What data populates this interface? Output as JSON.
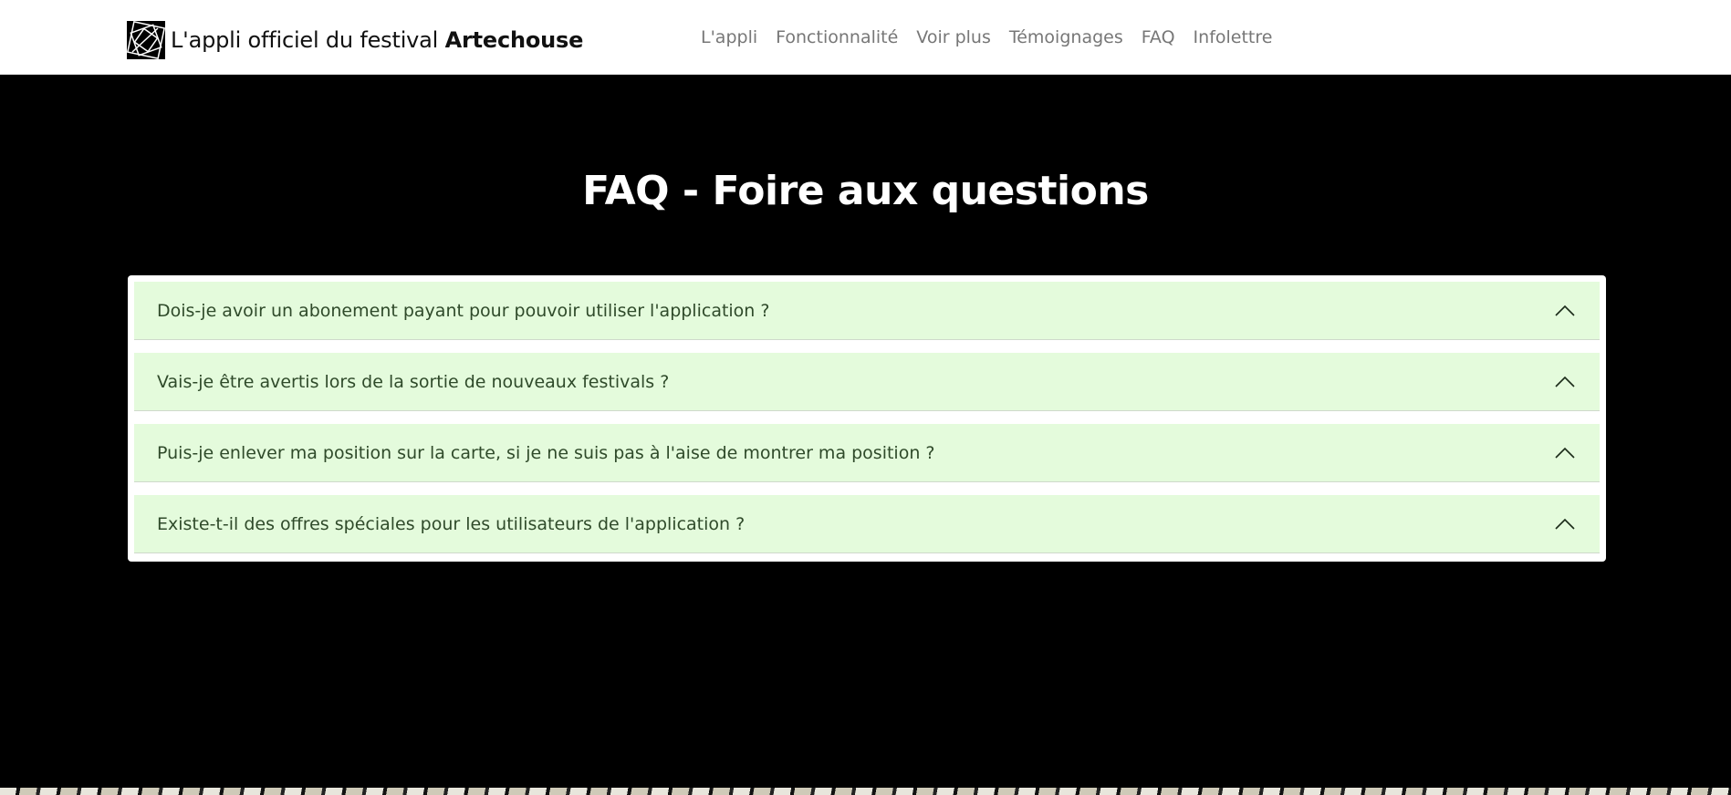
{
  "brand": {
    "prefix": "L'appli officiel du festival ",
    "name": "Artechouse",
    "logo_icon": "artechouse-logo-icon"
  },
  "nav": {
    "items": [
      {
        "label": "L'appli"
      },
      {
        "label": "Fonctionnalité"
      },
      {
        "label": "Voir plus"
      },
      {
        "label": "Témoignages"
      },
      {
        "label": "FAQ"
      },
      {
        "label": "Infolettre"
      }
    ]
  },
  "faq": {
    "title": "FAQ - Foire aux questions",
    "questions": [
      {
        "text": "Dois-je avoir un abonement payant pour pouvoir utiliser l'application ?",
        "icon": "chevron-up-icon"
      },
      {
        "text": "Vais-je être avertis lors de la sortie de nouveaux festivals ?",
        "icon": "chevron-up-icon"
      },
      {
        "text": "Puis-je enlever ma position sur la carte, si je ne suis pas à l'aise de montrer ma position ?",
        "icon": "chevron-up-icon"
      },
      {
        "text": "Existe-t-il des offres spéciales pour les utilisateurs de l'application ?",
        "icon": "chevron-up-icon"
      }
    ]
  },
  "colors": {
    "navbar_bg": "#ffffff",
    "page_bg": "#000000",
    "accordion_item_bg": "#e4fbdc",
    "question_text": "#2f4a2a",
    "nav_link": "#777777"
  }
}
